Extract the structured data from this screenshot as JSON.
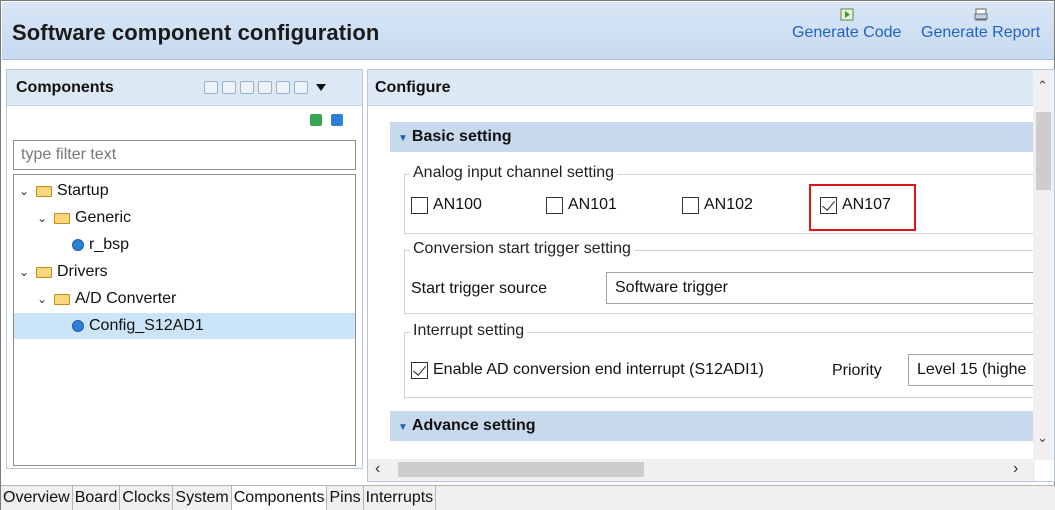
{
  "header": {
    "title": "Software component configuration",
    "generate_code": "Generate Code",
    "generate_report": "Generate Report"
  },
  "components": {
    "label": "Components",
    "filter_placeholder": "type filter text",
    "tree": [
      {
        "label": "Startup",
        "kind": "folder",
        "level": 0,
        "expanded": true
      },
      {
        "label": "Generic",
        "kind": "folder",
        "level": 1,
        "expanded": true
      },
      {
        "label": "r_bsp",
        "kind": "component",
        "level": 2
      },
      {
        "label": "Drivers",
        "kind": "folder",
        "level": 0,
        "expanded": true
      },
      {
        "label": "A/D Converter",
        "kind": "folder",
        "level": 1,
        "expanded": true
      },
      {
        "label": "Config_S12AD1",
        "kind": "component",
        "level": 2,
        "selected": true
      }
    ]
  },
  "configure": {
    "label": "Configure",
    "basic_setting": "Basic setting",
    "advance_setting": "Advance setting",
    "analog_group": {
      "title": "Analog input channel setting",
      "channels": [
        {
          "label": "AN100",
          "checked": false
        },
        {
          "label": "AN101",
          "checked": false
        },
        {
          "label": "AN102",
          "checked": false
        },
        {
          "label": "AN107",
          "checked": true
        }
      ]
    },
    "trigger_group": {
      "title": "Conversion start trigger setting",
      "source_label": "Start trigger source",
      "source_value": "Software trigger"
    },
    "interrupt_group": {
      "title": "Interrupt setting",
      "enable_label": "Enable AD conversion end interrupt (S12ADI1)",
      "enable_checked": true,
      "priority_label": "Priority",
      "priority_value": "Level 15 (highe"
    }
  },
  "tabs": [
    "Overview",
    "Board",
    "Clocks",
    "System",
    "Components",
    "Pins",
    "Interrupts"
  ],
  "active_tab": "Components",
  "colors": {
    "link": "#1f63c4",
    "header_bg": "#dde8f5",
    "section_bg": "#c8d9ee",
    "selection": "#cce4f7",
    "highlight": "#e01414"
  }
}
